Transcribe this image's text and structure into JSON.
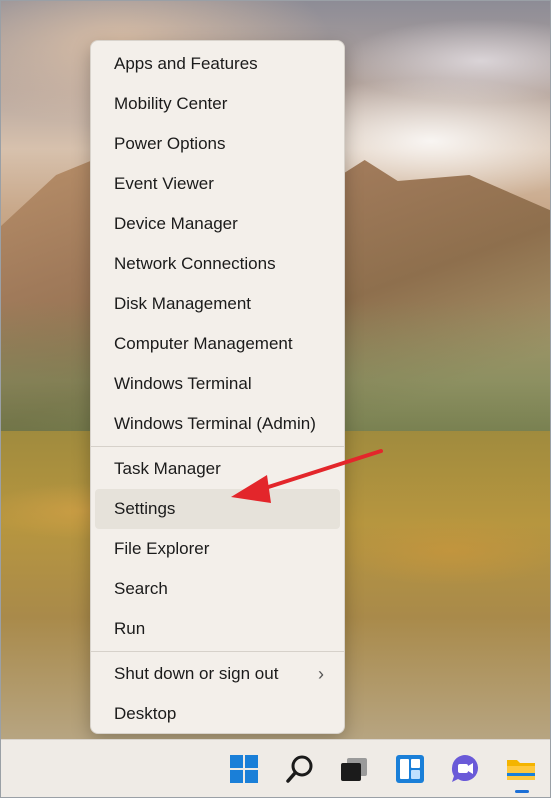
{
  "menu": {
    "groups": [
      [
        "Apps and Features",
        "Mobility Center",
        "Power Options",
        "Event Viewer",
        "Device Manager",
        "Network Connections",
        "Disk Management",
        "Computer Management",
        "Windows Terminal",
        "Windows Terminal (Admin)"
      ],
      [
        "Task Manager",
        "Settings",
        "File Explorer",
        "Search",
        "Run"
      ],
      [
        "Shut down or sign out",
        "Desktop"
      ]
    ],
    "highlighted_item": "Settings",
    "submenu_item": "Shut down or sign out",
    "submenu_chevron": "›"
  },
  "annotation": {
    "type": "arrow",
    "color": "#e3262b",
    "points_to": "Settings"
  },
  "taskbar": {
    "icons": [
      "windows-start-icon",
      "search-icon",
      "task-view-icon",
      "widgets-icon",
      "teams-chat-icon",
      "file-explorer-icon"
    ],
    "active_icon": "file-explorer-icon",
    "accent": "#1c6fd6"
  }
}
